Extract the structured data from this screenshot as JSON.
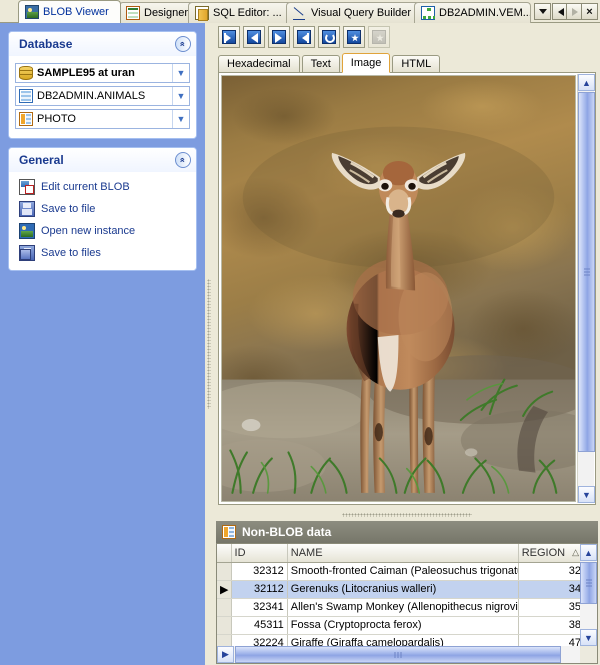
{
  "window": {
    "tabs": [
      {
        "label": "BLOB Viewer",
        "icon": "picture-icon",
        "active": true
      },
      {
        "label": "Designer",
        "icon": "grid-icon",
        "active": false
      },
      {
        "label": "SQL Editor: ...",
        "icon": "document-icon",
        "active": false
      },
      {
        "label": "Visual Query Builder",
        "icon": "pencil-ruler-icon",
        "active": false
      },
      {
        "label": "DB2ADMIN.VEM...",
        "icon": "tree-icon",
        "active": false
      }
    ],
    "controls": [
      {
        "name": "tab-list-dropdown",
        "glyph": "dropdown-icon"
      },
      {
        "name": "tab-scroll-left",
        "glyph": "left-arrow-icon"
      },
      {
        "name": "tab-scroll-right",
        "glyph": "right-arrow-icon"
      },
      {
        "name": "close-tab",
        "glyph": "close-icon",
        "label": "×"
      }
    ]
  },
  "sidebar": {
    "database_panel": {
      "title": "Database",
      "collapse_glyph": "«",
      "fields": [
        {
          "name": "connection-combo",
          "icon": "database-icon",
          "value": "SAMPLE95 at uran",
          "bold": true
        },
        {
          "name": "table-combo",
          "icon": "table-icon",
          "value": "DB2ADMIN.ANIMALS",
          "bold": false
        },
        {
          "name": "column-combo",
          "icon": "column-icon",
          "value": "PHOTO",
          "bold": false
        }
      ]
    },
    "general_panel": {
      "title": "General",
      "collapse_glyph": "«",
      "actions": [
        {
          "name": "edit-current-blob",
          "icon": "edit-blob-icon",
          "label": "Edit current BLOB"
        },
        {
          "name": "save-to-file",
          "icon": "save-icon",
          "label": "Save to file"
        },
        {
          "name": "open-new-instance",
          "icon": "open-image-icon",
          "label": "Open new instance"
        },
        {
          "name": "save-to-files",
          "icon": "save-multiple-icon",
          "label": "Save to files"
        }
      ]
    }
  },
  "toolbar": {
    "buttons": [
      {
        "name": "first-record-button",
        "icon": "first-record-icon",
        "enabled": true
      },
      {
        "name": "prior-record-button",
        "icon": "prior-record-icon",
        "enabled": true
      },
      {
        "name": "next-record-button",
        "icon": "next-record-icon",
        "enabled": true
      },
      {
        "name": "last-record-button",
        "icon": "last-record-icon",
        "enabled": true
      },
      {
        "name": "refresh-button",
        "icon": "refresh-icon",
        "enabled": true
      },
      {
        "name": "load-blob-button",
        "icon": "star-icon",
        "enabled": true
      },
      {
        "name": "clear-blob-button",
        "icon": "star-disabled-icon",
        "enabled": false
      }
    ]
  },
  "viewer": {
    "tabs": [
      {
        "label": "Hexadecimal",
        "accesskey": "x",
        "active": false
      },
      {
        "label": "Text",
        "accesskey": "T",
        "active": false
      },
      {
        "label": "Image",
        "accesskey": "I",
        "active": true
      },
      {
        "label": "HTML",
        "accesskey": "H",
        "active": false
      }
    ],
    "image_alt": "Gerenuk antelope standing on dirt ground with grass",
    "scrollbar": {
      "up_glyph": "▲",
      "down_glyph": "▼"
    }
  },
  "grid": {
    "title": "Non-BLOB data",
    "icon": "table-data-icon",
    "columns": [
      {
        "key": "marker",
        "label": ""
      },
      {
        "key": "id",
        "label": "ID"
      },
      {
        "key": "name",
        "label": "NAME"
      },
      {
        "key": "region",
        "label": "REGION",
        "sort": "△"
      }
    ],
    "rows": [
      {
        "marker": "",
        "id": "32312",
        "name": "Smooth-fronted Caiman (Paleosuchus trigonatus)",
        "region": "32",
        "selected": false
      },
      {
        "marker": "▶",
        "id": "32112",
        "name": "Gerenuks (Litocranius walleri)",
        "region": "34",
        "selected": true
      },
      {
        "marker": "",
        "id": "32341",
        "name": "Allen's Swamp Monkey (Allenopithecus nigroviridis)",
        "region": "35",
        "selected": false
      },
      {
        "marker": "",
        "id": "45311",
        "name": "Fossa (Cryptoprocta ferox)",
        "region": "38",
        "selected": false
      },
      {
        "marker": "",
        "id": "32224",
        "name": "Giraffe (Giraffa camelopardalis)",
        "region": "47",
        "selected": false
      }
    ],
    "scrollbars": {
      "v_up": "▲",
      "v_down": "▼",
      "h_left": "◀",
      "h_right": "▶"
    }
  },
  "colors": {
    "sidebar_bg": "#7d9ce0",
    "panel_title": "#1a3a8f",
    "chrome_bg": "#ece9d8",
    "grid_header_bg": "#7e7e72",
    "selection_bg": "#c2d2ef",
    "active_tab_text": "#00309c"
  }
}
